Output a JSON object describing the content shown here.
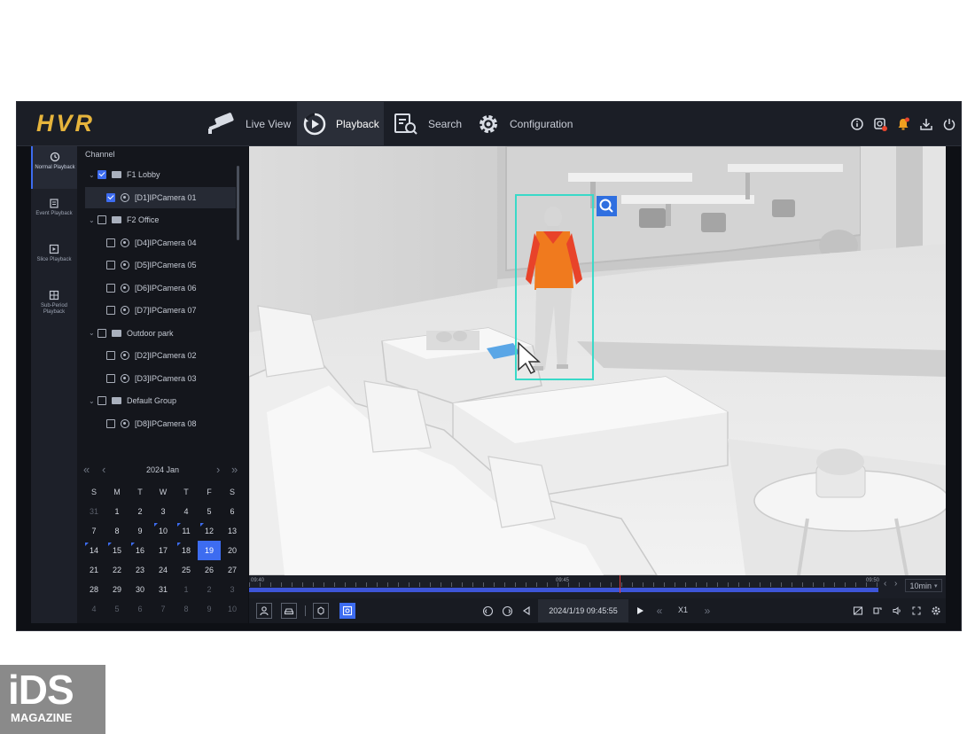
{
  "app": {
    "logo": "HVR"
  },
  "nav": [
    {
      "label": "Live View",
      "icon": "camera-icon"
    },
    {
      "label": "Playback",
      "icon": "playback-icon",
      "active": true
    },
    {
      "label": "Search",
      "icon": "search-doc-icon"
    },
    {
      "label": "Configuration",
      "icon": "gear-icon"
    }
  ],
  "toolbar_icons": [
    "info-icon",
    "record-status-icon",
    "alarm-bell-icon",
    "download-icon",
    "power-icon"
  ],
  "rail": [
    {
      "label": "Normal Playback",
      "icon": "normal-playback-icon",
      "active": true
    },
    {
      "label": "Event Playback",
      "icon": "event-playback-icon"
    },
    {
      "label": "Slice Playback",
      "icon": "slice-playback-icon"
    },
    {
      "label": "Sub-Period Playback",
      "icon": "sub-period-playback-icon"
    }
  ],
  "channels": {
    "title": "Channel",
    "tree": [
      {
        "type": "group",
        "label": "F1 Lobby",
        "checked": true
      },
      {
        "type": "camera",
        "label": "[D1]IPCamera 01",
        "checked": true,
        "selected": true
      },
      {
        "type": "group",
        "label": "F2 Office",
        "checked": false
      },
      {
        "type": "camera",
        "label": "[D4]IPCamera 04",
        "checked": false
      },
      {
        "type": "camera",
        "label": "[D5]IPCamera 05",
        "checked": false
      },
      {
        "type": "camera",
        "label": "[D6]IPCamera 06",
        "checked": false
      },
      {
        "type": "camera",
        "label": "[D7]IPCamera 07",
        "checked": false
      },
      {
        "type": "group",
        "label": "Outdoor park",
        "checked": false
      },
      {
        "type": "camera",
        "label": "[D2]IPCamera 02",
        "checked": false
      },
      {
        "type": "camera",
        "label": "[D3]IPCamera 03",
        "checked": false
      },
      {
        "type": "group",
        "label": "Default Group",
        "checked": false
      },
      {
        "type": "camera",
        "label": "[D8]IPCamera 08",
        "checked": false
      }
    ]
  },
  "calendar": {
    "month_label": "2024 Jan",
    "weekdays": [
      "S",
      "M",
      "T",
      "W",
      "T",
      "F",
      "S"
    ],
    "days": [
      {
        "d": "31",
        "m": true
      },
      {
        "d": "1"
      },
      {
        "d": "2"
      },
      {
        "d": "3"
      },
      {
        "d": "4"
      },
      {
        "d": "5"
      },
      {
        "d": "6"
      },
      {
        "d": "7"
      },
      {
        "d": "8"
      },
      {
        "d": "9"
      },
      {
        "d": "10",
        "rec": true
      },
      {
        "d": "11",
        "rec": true
      },
      {
        "d": "12",
        "rec": true
      },
      {
        "d": "13"
      },
      {
        "d": "14",
        "rec": true
      },
      {
        "d": "15",
        "rec": true
      },
      {
        "d": "16",
        "rec": true
      },
      {
        "d": "17"
      },
      {
        "d": "18",
        "rec": true
      },
      {
        "d": "19",
        "today": true
      },
      {
        "d": "20"
      },
      {
        "d": "21"
      },
      {
        "d": "22"
      },
      {
        "d": "23"
      },
      {
        "d": "24"
      },
      {
        "d": "25"
      },
      {
        "d": "26"
      },
      {
        "d": "27"
      },
      {
        "d": "28"
      },
      {
        "d": "29"
      },
      {
        "d": "30"
      },
      {
        "d": "31"
      },
      {
        "d": "1",
        "m": true
      },
      {
        "d": "2",
        "m": true
      },
      {
        "d": "3",
        "m": true
      },
      {
        "d": "4",
        "m": true
      },
      {
        "d": "5",
        "m": true
      },
      {
        "d": "6",
        "m": true
      },
      {
        "d": "7",
        "m": true
      },
      {
        "d": "8",
        "m": true
      },
      {
        "d": "9",
        "m": true
      },
      {
        "d": "10",
        "m": true
      }
    ]
  },
  "timeline": {
    "start": "09:40",
    "mid": "09:45",
    "end": "09:50",
    "zoom": "10min",
    "position": 0.59
  },
  "controls": {
    "datetime": "2024/1/19 09:45:55",
    "speed": "X1"
  },
  "colors": {
    "accent": "#3d6cf0",
    "logo": "#e6b43c",
    "detection": "#39d9c8",
    "alarm": "#e8462e"
  },
  "watermark": {
    "big": "iDS",
    "small": "MAGAZINE"
  }
}
